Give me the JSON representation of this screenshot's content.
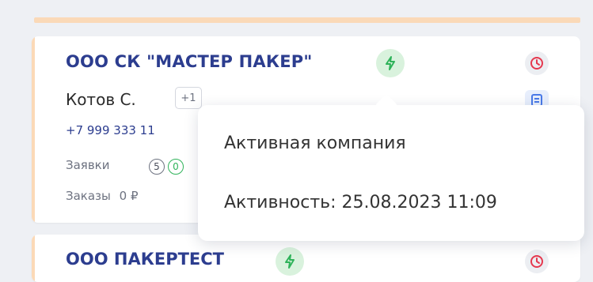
{
  "cards": [
    {
      "company": "ООО СК \"МАСТЕР ПАКЕР\"",
      "contact_name": "Котов С.",
      "extra_contacts": "+1",
      "phone": "+7 999 333 11",
      "requests_label": "Заявки",
      "requests_counts": [
        "5",
        "0"
      ],
      "orders_label": "Заказы",
      "orders_value": "0 ₽",
      "status_icon": "lightning-icon",
      "action_icons": [
        "clock-icon",
        "document-icon"
      ]
    },
    {
      "company": "ООО ПАКЕРТЕСТ",
      "status_icon": "lightning-icon",
      "action_icons": [
        "clock-icon"
      ]
    }
  ],
  "tooltip": {
    "status": "Активная компания",
    "activity": "Активность: 25.08.2023 11:09"
  },
  "colors": {
    "accent": "#fbd9b7",
    "company_link": "#2c3d8f",
    "active_green": "#2fb35a",
    "clock_red": "#e5394f",
    "doc_blue": "#4a7ae8"
  }
}
